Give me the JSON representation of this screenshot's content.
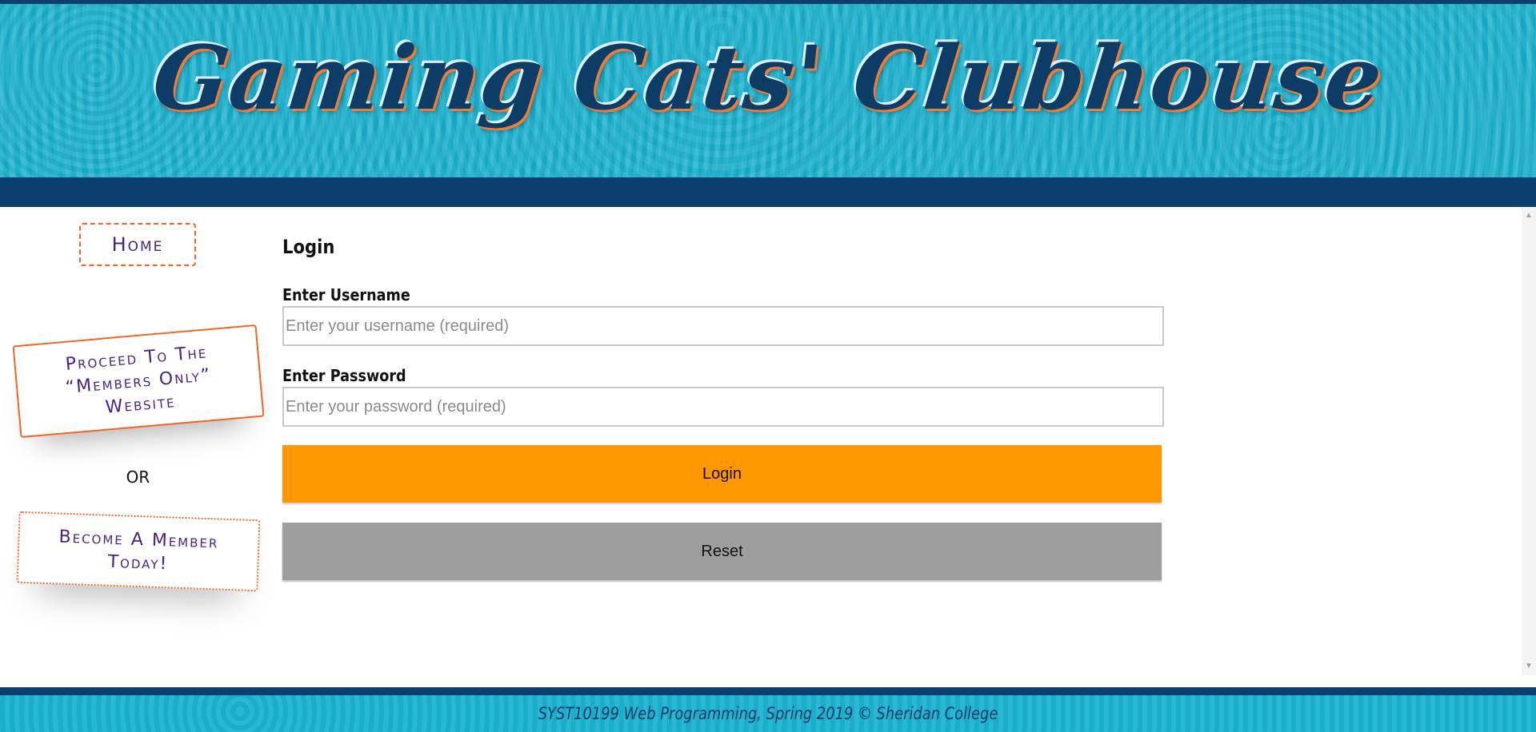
{
  "header": {
    "title": "Gaming Cats' Clubhouse"
  },
  "sidebar": {
    "home_label": "Home",
    "proceed_label": "Proceed To The “Members Only” Website",
    "or_label": "OR",
    "become_label": "Become A Member Today!"
  },
  "form": {
    "heading": "Login",
    "username_label": "Enter Username",
    "username_placeholder": "Enter your username (required)",
    "username_value": "",
    "password_label": "Enter Password",
    "password_placeholder": "Enter your password (required)",
    "password_value": "",
    "login_label": "Login",
    "reset_label": "Reset"
  },
  "scrollbar": {
    "up_icon": "▲",
    "down_icon": "▼"
  },
  "footer": {
    "text": "SYST10199 Web Programming, Spring 2019 © Sheridan College"
  },
  "colors": {
    "header_bg": "#1bb3d1",
    "nav_bar": "#0b3f6e",
    "accent_orange": "#f26522",
    "login_button": "#fe9702",
    "reset_button": "#9e9e9e",
    "sidebar_text": "#4a2280"
  }
}
